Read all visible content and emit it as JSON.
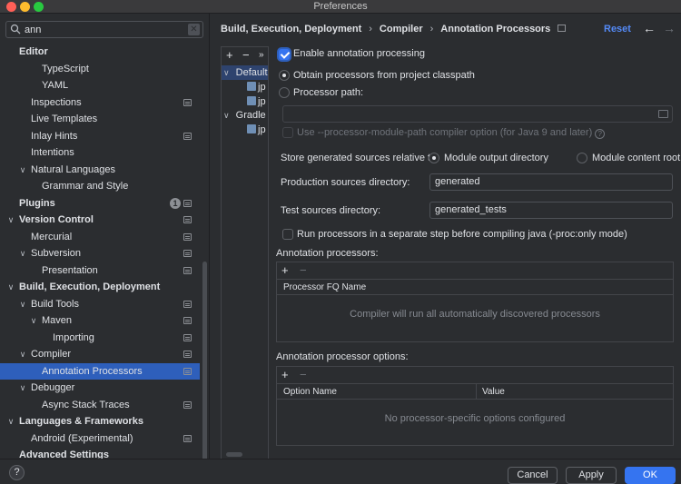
{
  "window": {
    "title": "Preferences"
  },
  "search": {
    "value": "ann"
  },
  "sidebar": {
    "items": [
      {
        "label": "Editor",
        "level": 0,
        "bold": true,
        "chevron": "",
        "page_icon": false
      },
      {
        "label": "TypeScript",
        "level": 2,
        "bold": false,
        "chevron": "",
        "page_icon": false
      },
      {
        "label": "YAML",
        "level": 2,
        "bold": false,
        "chevron": "",
        "page_icon": false
      },
      {
        "label": "Inspections",
        "level": 1,
        "bold": false,
        "chevron": "",
        "page_icon": true
      },
      {
        "label": "Live Templates",
        "level": 1,
        "bold": false,
        "chevron": "",
        "page_icon": false
      },
      {
        "label": "Inlay Hints",
        "level": 1,
        "bold": false,
        "chevron": "",
        "page_icon": true
      },
      {
        "label": "Intentions",
        "level": 1,
        "bold": false,
        "chevron": "",
        "page_icon": false
      },
      {
        "label": "Natural Languages",
        "level": 1,
        "bold": false,
        "chevron": "down",
        "page_icon": false
      },
      {
        "label": "Grammar and Style",
        "level": 2,
        "bold": false,
        "chevron": "",
        "page_icon": false
      },
      {
        "label": "Plugins",
        "level": 0,
        "bold": true,
        "chevron": "",
        "page_icon": true,
        "badge": "1"
      },
      {
        "label": "Version Control",
        "level": 0,
        "bold": true,
        "chevron": "down",
        "page_icon": true
      },
      {
        "label": "Mercurial",
        "level": 1,
        "bold": false,
        "chevron": "",
        "page_icon": true
      },
      {
        "label": "Subversion",
        "level": 1,
        "bold": false,
        "chevron": "down",
        "page_icon": true
      },
      {
        "label": "Presentation",
        "level": 2,
        "bold": false,
        "chevron": "",
        "page_icon": true
      },
      {
        "label": "Build, Execution, Deployment",
        "level": 0,
        "bold": true,
        "chevron": "down",
        "page_icon": false
      },
      {
        "label": "Build Tools",
        "level": 1,
        "bold": false,
        "chevron": "down",
        "page_icon": true
      },
      {
        "label": "Maven",
        "level": 2,
        "bold": false,
        "chevron": "down",
        "page_icon": true
      },
      {
        "label": "Importing",
        "level": 3,
        "bold": false,
        "chevron": "",
        "page_icon": true
      },
      {
        "label": "Compiler",
        "level": 1,
        "bold": false,
        "chevron": "down",
        "page_icon": true
      },
      {
        "label": "Annotation Processors",
        "level": 2,
        "bold": false,
        "chevron": "",
        "page_icon": true,
        "selected": true
      },
      {
        "label": "Debugger",
        "level": 1,
        "bold": false,
        "chevron": "down",
        "page_icon": false
      },
      {
        "label": "Async Stack Traces",
        "level": 2,
        "bold": false,
        "chevron": "",
        "page_icon": true
      },
      {
        "label": "Languages & Frameworks",
        "level": 0,
        "bold": true,
        "chevron": "down",
        "page_icon": false
      },
      {
        "label": "Android (Experimental)",
        "level": 1,
        "bold": false,
        "chevron": "",
        "page_icon": true
      },
      {
        "label": "Advanced Settings",
        "level": 0,
        "bold": true,
        "chevron": "",
        "page_icon": false
      }
    ]
  },
  "breadcrumb": {
    "part1": "Build, Execution, Deployment",
    "sep": "›",
    "part2": "Compiler",
    "part3": "Annotation Processors"
  },
  "header": {
    "reset": "Reset",
    "back": "←",
    "forward": "→"
  },
  "profiles": {
    "add": "+",
    "remove": "−",
    "more": "»",
    "default_label": "Default",
    "gradle_label": "Gradle I",
    "file_label": "jp"
  },
  "form": {
    "enable_label": "Enable annotation processing",
    "enable_checked": true,
    "obtain_classpath_label": "Obtain processors from project classpath",
    "processor_path_label": "Processor path:",
    "processor_path_value": "",
    "module_path_label": "Use --processor-module-path compiler option (for Java 9 and later)",
    "store_label": "Store generated sources relative to:",
    "module_output_label": "Module output directory",
    "module_content_label": "Module content root",
    "prod_dir_label": "Production sources directory:",
    "prod_dir_value": "generated",
    "test_dir_label": "Test sources directory:",
    "test_dir_value": "generated_tests",
    "separate_step_label": "Run processors in a separate step before compiling java (-proc:only mode)"
  },
  "processors_table": {
    "title": "Annotation processors:",
    "add": "+",
    "remove": "−",
    "column": "Processor FQ Name",
    "empty": "Compiler will run all automatically discovered processors"
  },
  "options_table": {
    "title": "Annotation processor options:",
    "add": "+",
    "remove": "−",
    "col_name": "Option Name",
    "col_value": "Value",
    "empty": "No processor-specific options configured"
  },
  "footer": {
    "help": "?",
    "cancel": "Cancel",
    "apply": "Apply",
    "ok": "OK"
  },
  "colors": {
    "accent": "#3574f0",
    "selection": "#2e5fbb",
    "link": "#548af7"
  }
}
